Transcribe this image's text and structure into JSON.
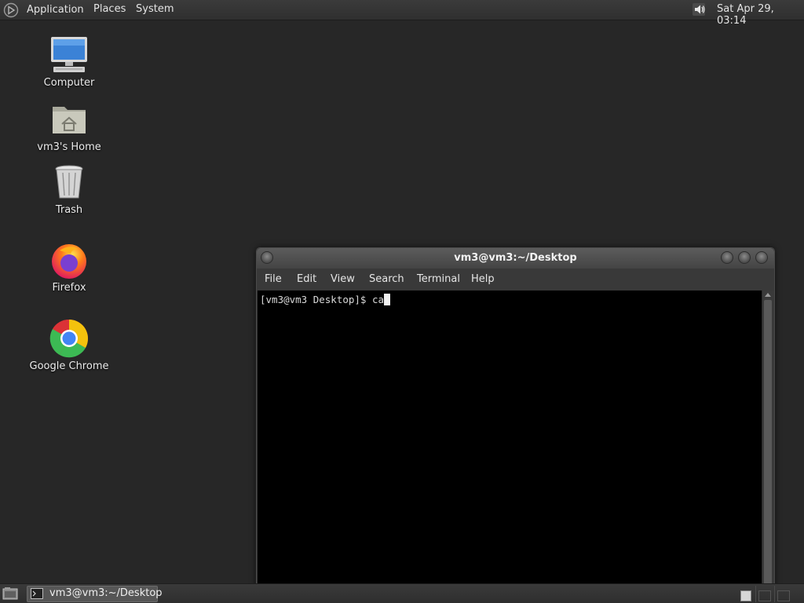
{
  "top_panel": {
    "applications_label": "Applications",
    "places_label": "Places",
    "system_label": "System",
    "clock": "Sat Apr 29, 03:14"
  },
  "desktop_icons": [
    {
      "label": "Computer",
      "icon": "computer-icon"
    },
    {
      "label": "vm3's Home",
      "icon": "home-folder-icon"
    },
    {
      "label": "Trash",
      "icon": "trash-icon"
    },
    {
      "label": "Firefox",
      "icon": "firefox-icon"
    },
    {
      "label": "Google Chrome",
      "icon": "chrome-icon"
    }
  ],
  "terminal": {
    "title": "vm3@vm3:~/Desktop",
    "menu": [
      "File",
      "Edit",
      "View",
      "Search",
      "Terminal",
      "Help"
    ],
    "prompt": "[vm3@vm3 Desktop]$ ",
    "typed": "ca"
  },
  "bottom_panel": {
    "task_label": "vm3@vm3:~/Desktop"
  },
  "colors": {
    "desktop_bg": "#272727",
    "terminal_bg": "#000000",
    "panel_bg": "#353535"
  }
}
